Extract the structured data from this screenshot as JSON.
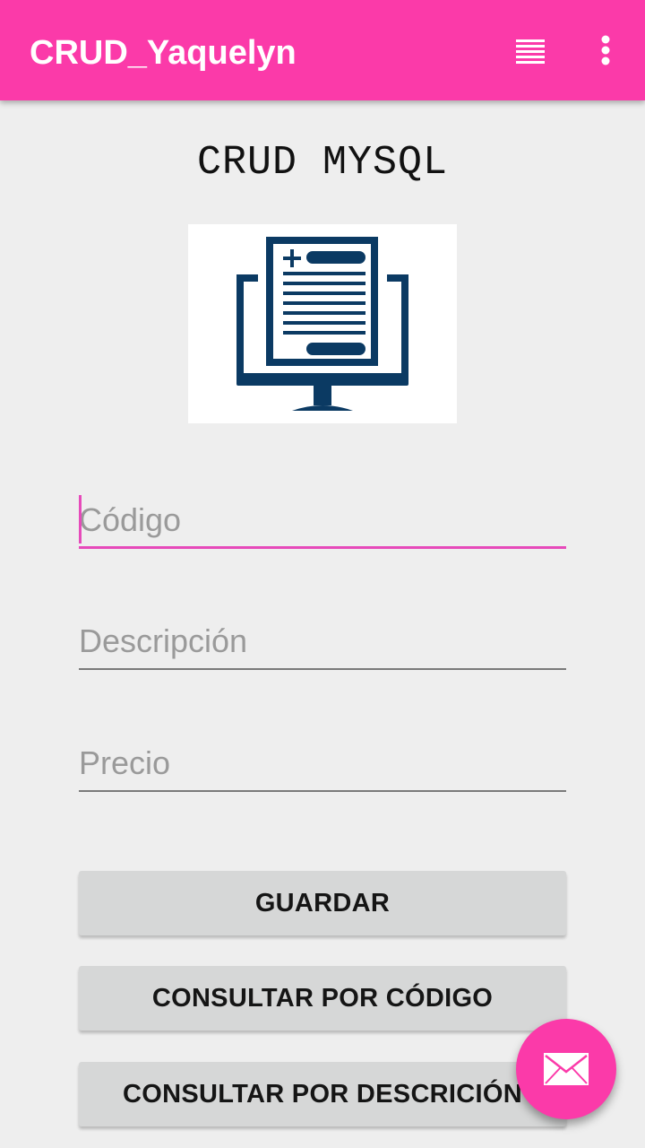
{
  "appbar": {
    "title": "CRUD_Yaquelyn",
    "background_color": "#fb3aa9",
    "actions": [
      {
        "icon": "view-list-icon"
      },
      {
        "icon": "more-vert-icon"
      }
    ]
  },
  "main": {
    "heading": "CRUD MYSQL",
    "logo_icon": "document-monitor-icon",
    "logo_color": "#0b3a63"
  },
  "form": {
    "codigo": {
      "placeholder": "Código",
      "value": ""
    },
    "descripcion": {
      "placeholder": "Descripción",
      "value": ""
    },
    "precio": {
      "placeholder": "Precio",
      "value": ""
    }
  },
  "buttons": {
    "guardar": "GUARDAR",
    "consultar_codigo": "CONSULTAR POR CÓDIGO",
    "consultar_descripcion": "CONSULTAR POR DESCRICIÓN"
  },
  "fab": {
    "icon": "email-icon",
    "color": "#fb3aa9"
  }
}
